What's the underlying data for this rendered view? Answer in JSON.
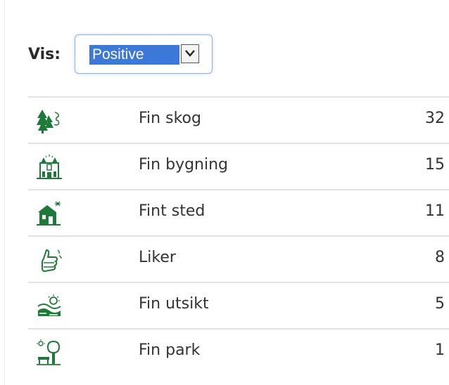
{
  "filter": {
    "label": "Vis:",
    "selected": "Positive"
  },
  "colors": {
    "icon_green": "#1f7a3a",
    "select_highlight": "#3c78d8",
    "divider": "#e2e2e2"
  },
  "rows": [
    {
      "icon": "forest-icon",
      "label": "Fin skog",
      "count": "32"
    },
    {
      "icon": "building-icon",
      "label": "Fin bygning",
      "count": "15"
    },
    {
      "icon": "house-icon",
      "label": "Fint sted",
      "count": "11"
    },
    {
      "icon": "thumbs-up-icon",
      "label": "Liker",
      "count": "8"
    },
    {
      "icon": "view-icon",
      "label": "Fin utsikt",
      "count": "5"
    },
    {
      "icon": "park-icon",
      "label": "Fin park",
      "count": "1"
    }
  ]
}
